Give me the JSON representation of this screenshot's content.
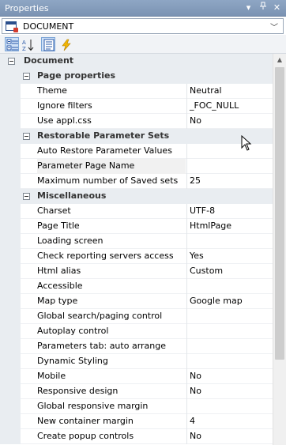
{
  "window": {
    "title": "Properties"
  },
  "selector": {
    "value": "DOCUMENT"
  },
  "toolbar": {
    "buttons": [
      {
        "icon": "categorized-icon",
        "active": true
      },
      {
        "icon": "sort-alphabetical-icon",
        "active": false
      },
      {
        "icon": "property-pages-icon",
        "active": true
      },
      {
        "icon": "events-lightning-icon",
        "active": false
      }
    ]
  },
  "grid": {
    "root": "Document",
    "categories": [
      {
        "label": "Page properties",
        "rows": [
          {
            "name": "Theme",
            "value": "Neutral"
          },
          {
            "name": "Ignore filters",
            "value": "_FOC_NULL"
          },
          {
            "name": "Use appl.css",
            "value": "No"
          }
        ]
      },
      {
        "label": "Restorable Parameter Sets",
        "rows": [
          {
            "name": "Auto Restore Parameter Values",
            "value": ""
          },
          {
            "name": "Parameter Page Name",
            "value": ""
          },
          {
            "name": "Maximum number of Saved sets",
            "value": "25"
          }
        ]
      },
      {
        "label": "Miscellaneous",
        "rows": [
          {
            "name": "Charset",
            "value": "UTF-8"
          },
          {
            "name": "Page Title",
            "value": "HtmlPage"
          },
          {
            "name": "Loading screen",
            "value": ""
          },
          {
            "name": "Check reporting servers access",
            "value": "Yes"
          },
          {
            "name": "Html alias",
            "value": "Custom"
          },
          {
            "name": "Accessible",
            "value": ""
          },
          {
            "name": "Map type",
            "value": "Google map"
          },
          {
            "name": "Global search/paging control",
            "value": ""
          },
          {
            "name": "Autoplay control",
            "value": ""
          },
          {
            "name": "Parameters tab: auto arrange",
            "value": ""
          },
          {
            "name": "Dynamic Styling",
            "value": ""
          },
          {
            "name": "Mobile",
            "value": "No"
          },
          {
            "name": "Responsive design",
            "value": "No"
          },
          {
            "name": "Global responsive margin",
            "value": ""
          },
          {
            "name": "New container margin",
            "value": "4"
          },
          {
            "name": "Create popup controls",
            "value": "No"
          }
        ]
      }
    ]
  }
}
